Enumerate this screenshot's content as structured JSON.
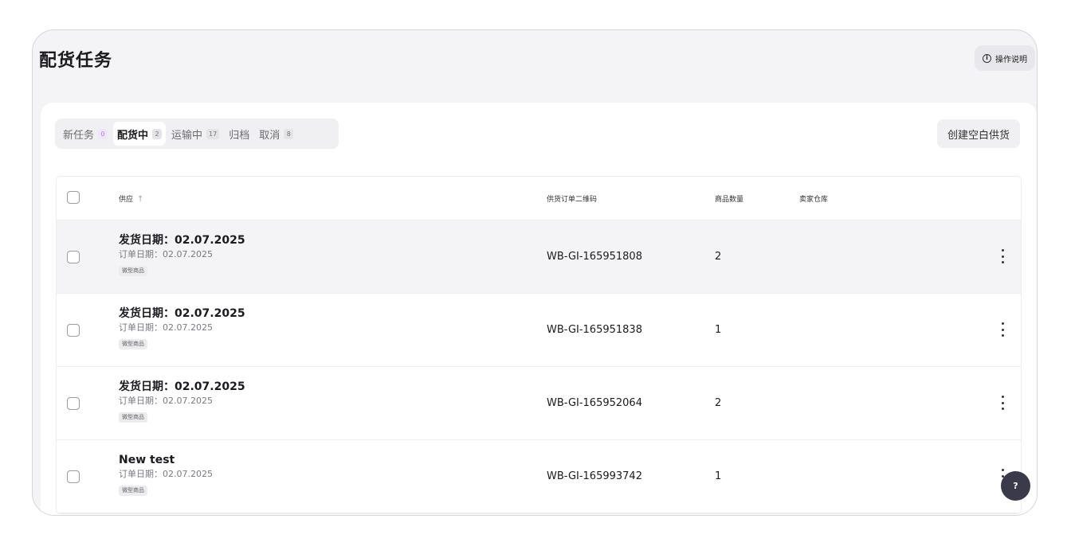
{
  "header": {
    "title": "配货任务",
    "help_label": "操作说明",
    "help_icon": "info-icon"
  },
  "tabs": [
    {
      "label": "新任务",
      "count": "0",
      "active": false,
      "count_color": "#a77cf2"
    },
    {
      "label": "配货中",
      "count": "2",
      "active": true
    },
    {
      "label": "运输中",
      "count": "17",
      "active": false
    },
    {
      "label": "归档",
      "count": "",
      "active": false
    },
    {
      "label": "取消",
      "count": "8",
      "active": false
    }
  ],
  "actions": {
    "create_label": "创建空白供货"
  },
  "table": {
    "columns": {
      "supply": "供应",
      "sort_indicator": "↑",
      "code": "供货订单二维码",
      "qty": "商品数量",
      "warehouse": "卖家仓库"
    },
    "rows": [
      {
        "title": "发货日期：02.07.2025",
        "order_date": "订单日期：02.07.2025",
        "tag": "微型商品",
        "code": "WB-GI-165951808",
        "qty": "2",
        "highlighted": true
      },
      {
        "title": "发货日期：02.07.2025",
        "order_date": "订单日期：02.07.2025",
        "tag": "微型商品",
        "code": "WB-GI-165951838",
        "qty": "1",
        "highlighted": false
      },
      {
        "title": "发货日期：02.07.2025",
        "order_date": "订单日期：02.07.2025",
        "tag": "微型商品",
        "code": "WB-GI-165952064",
        "qty": "2",
        "highlighted": false
      },
      {
        "title": "New test",
        "order_date": "订单日期：02.07.2025",
        "tag": "微型商品",
        "code": "WB-GI-165993742",
        "qty": "1",
        "highlighted": false
      }
    ]
  },
  "fab": {
    "label": "?"
  },
  "colors": {
    "accent_purple": "#a77cf2",
    "fab_bg": "#3a3a4a",
    "row_highlight": "#f4f4f6"
  }
}
